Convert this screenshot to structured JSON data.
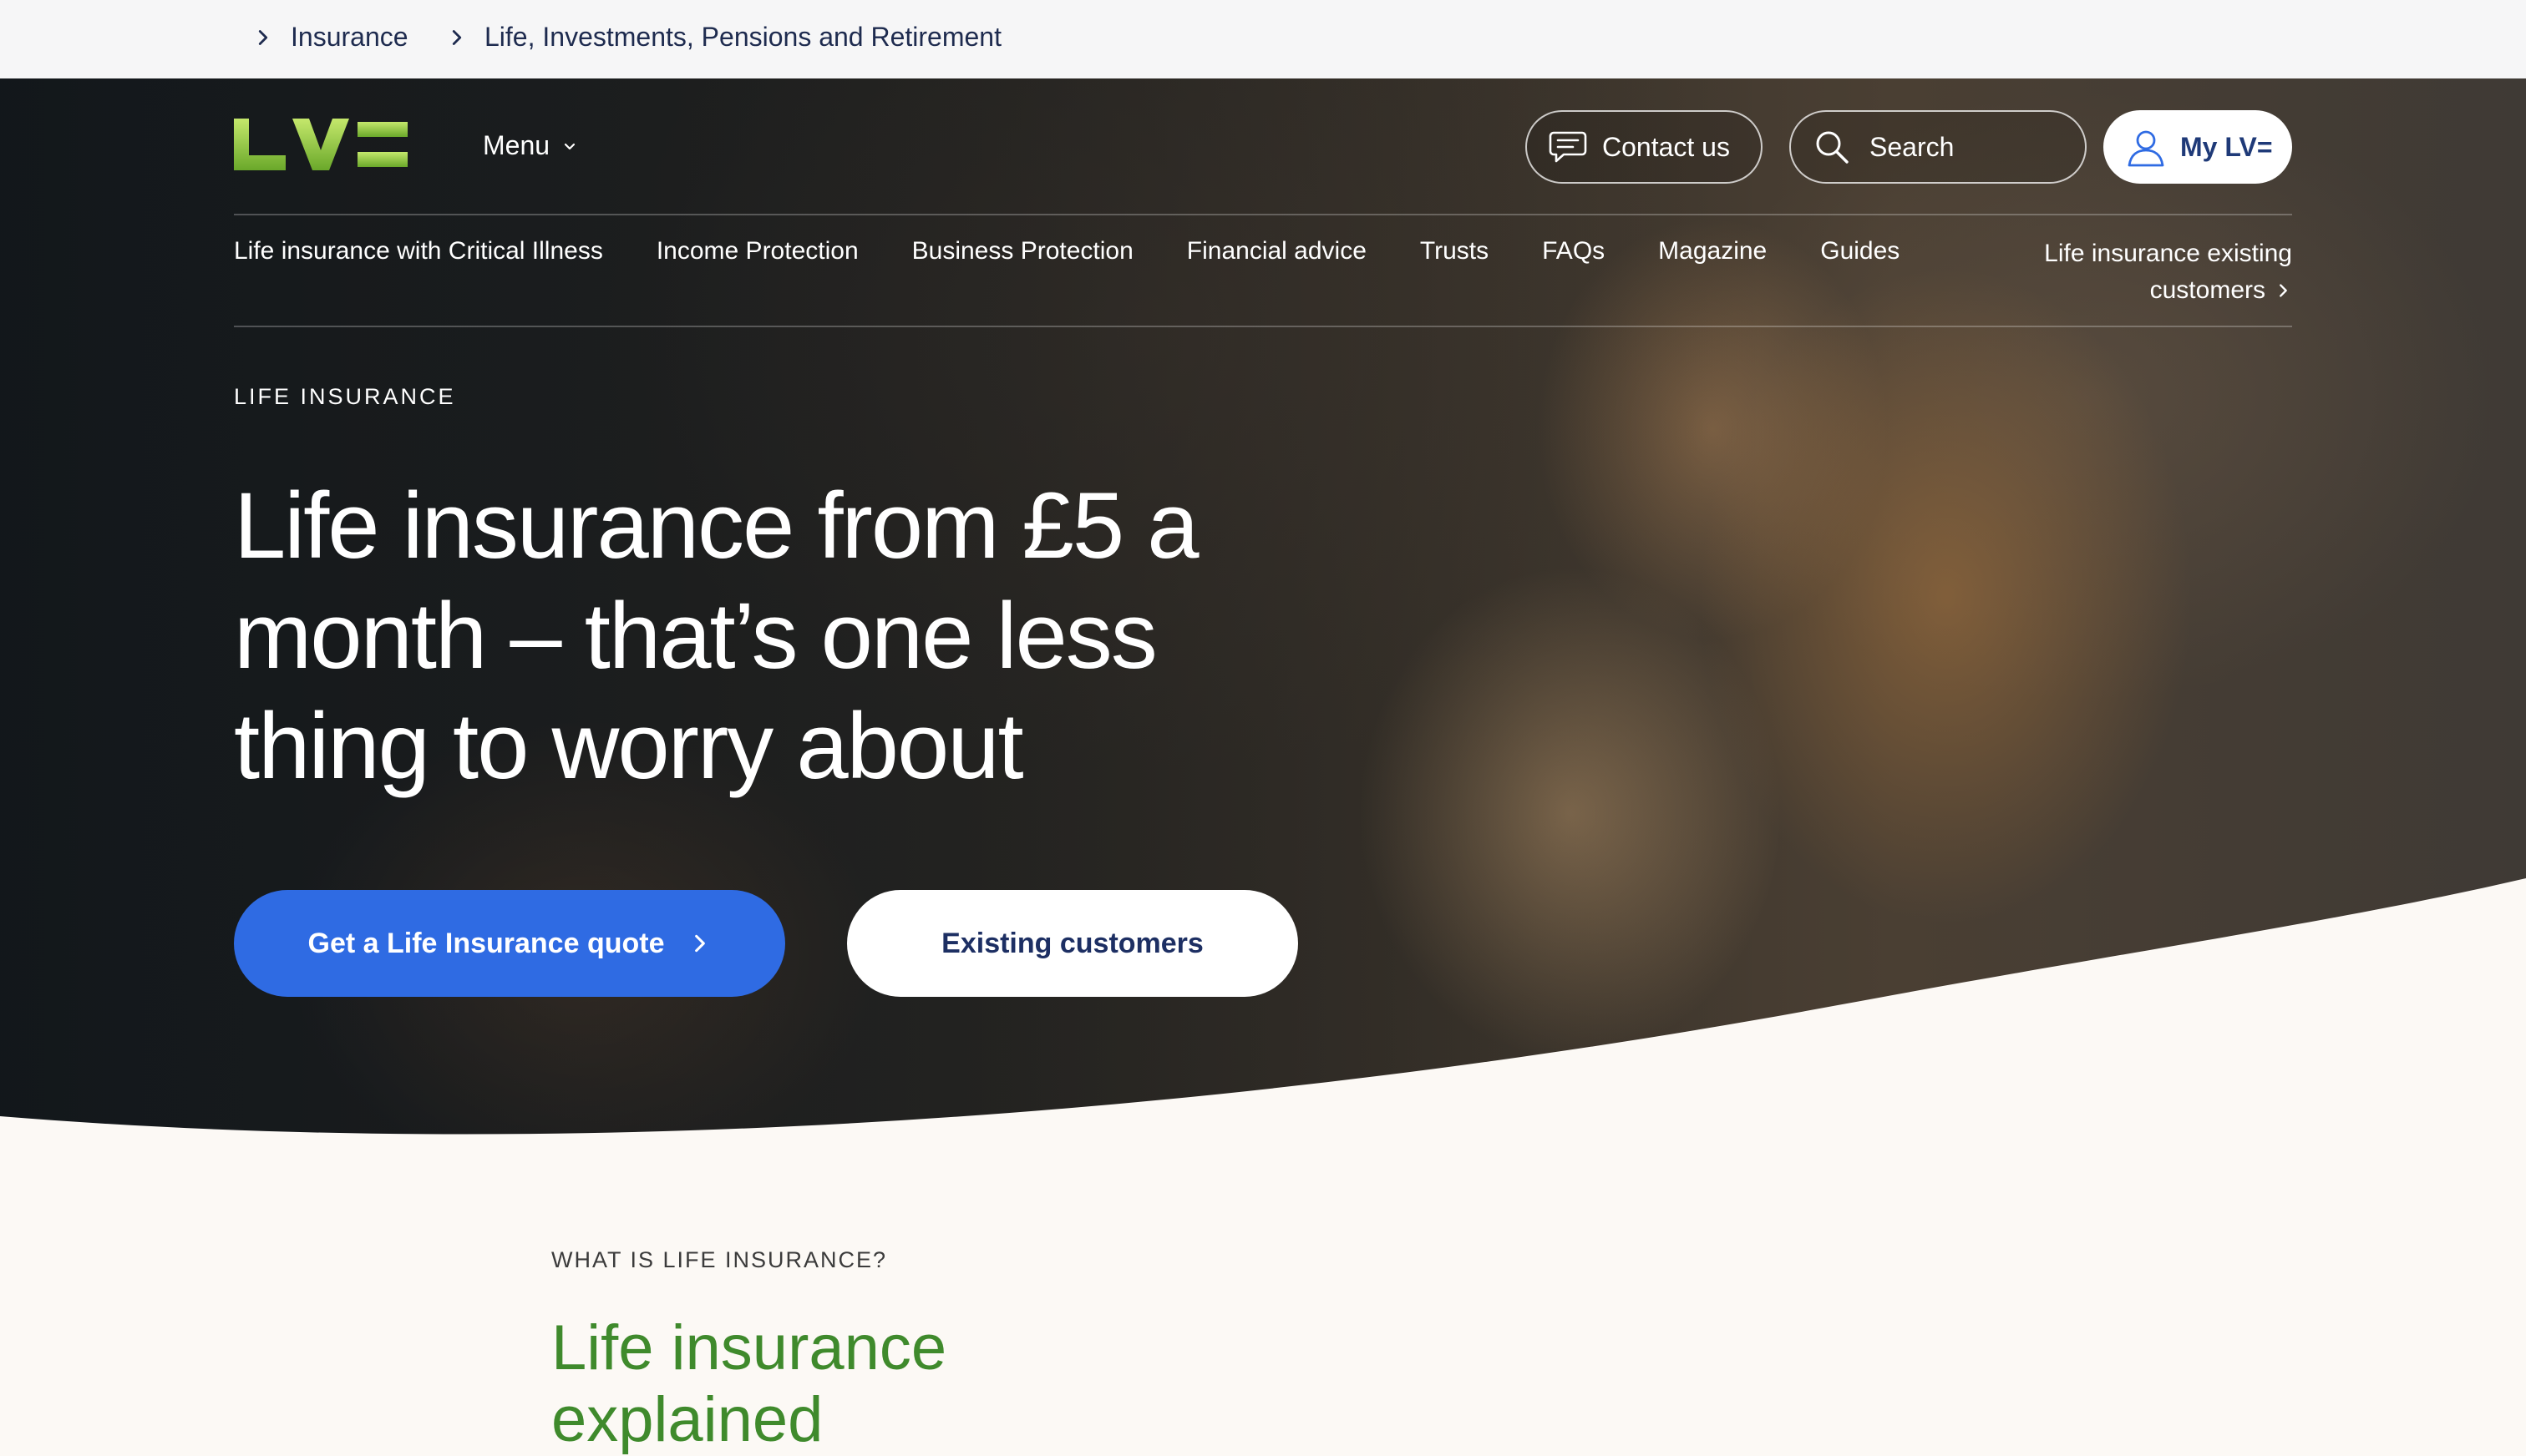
{
  "breadcrumb": {
    "items": [
      {
        "label": "Insurance"
      },
      {
        "label": "Life, Investments, Pensions and Retirement"
      }
    ]
  },
  "header": {
    "logo_text": "LV=",
    "menu_label": "Menu",
    "contact_label": "Contact us",
    "search_placeholder": "Search",
    "my_lv_label": "My LV="
  },
  "subnav": {
    "items": [
      {
        "label": "Life insurance with Critical Illness"
      },
      {
        "label": "Income Protection"
      },
      {
        "label": "Business Protection"
      },
      {
        "label": "Financial advice"
      },
      {
        "label": "Trusts"
      },
      {
        "label": "FAQs"
      },
      {
        "label": "Magazine"
      },
      {
        "label": "Guides"
      }
    ],
    "existing_line1": "Life insurance existing",
    "existing_line2": "customers"
  },
  "hero": {
    "eyebrow": "LIFE INSURANCE",
    "title": "Life insurance from £5 a month – that’s one less thing to worry about",
    "cta_quote": "Get a Life Insurance quote",
    "cta_existing": "Existing customers"
  },
  "section": {
    "eyebrow": "WHAT IS LIFE INSURANCE?",
    "title": "Life insurance explained"
  },
  "colors": {
    "brand_green": "#8cc63f",
    "cta_blue": "#2f6be3",
    "navy_text": "#1d2f63",
    "section_green": "#3f8a2c",
    "page_background": "#fcf9f5"
  },
  "icons": {
    "breadcrumb": "chevron-right-icon",
    "menu": "chevron-down-icon",
    "contact": "chat-bubble-icon",
    "search": "search-icon",
    "account": "user-icon",
    "cta": "chevron-right-icon"
  }
}
